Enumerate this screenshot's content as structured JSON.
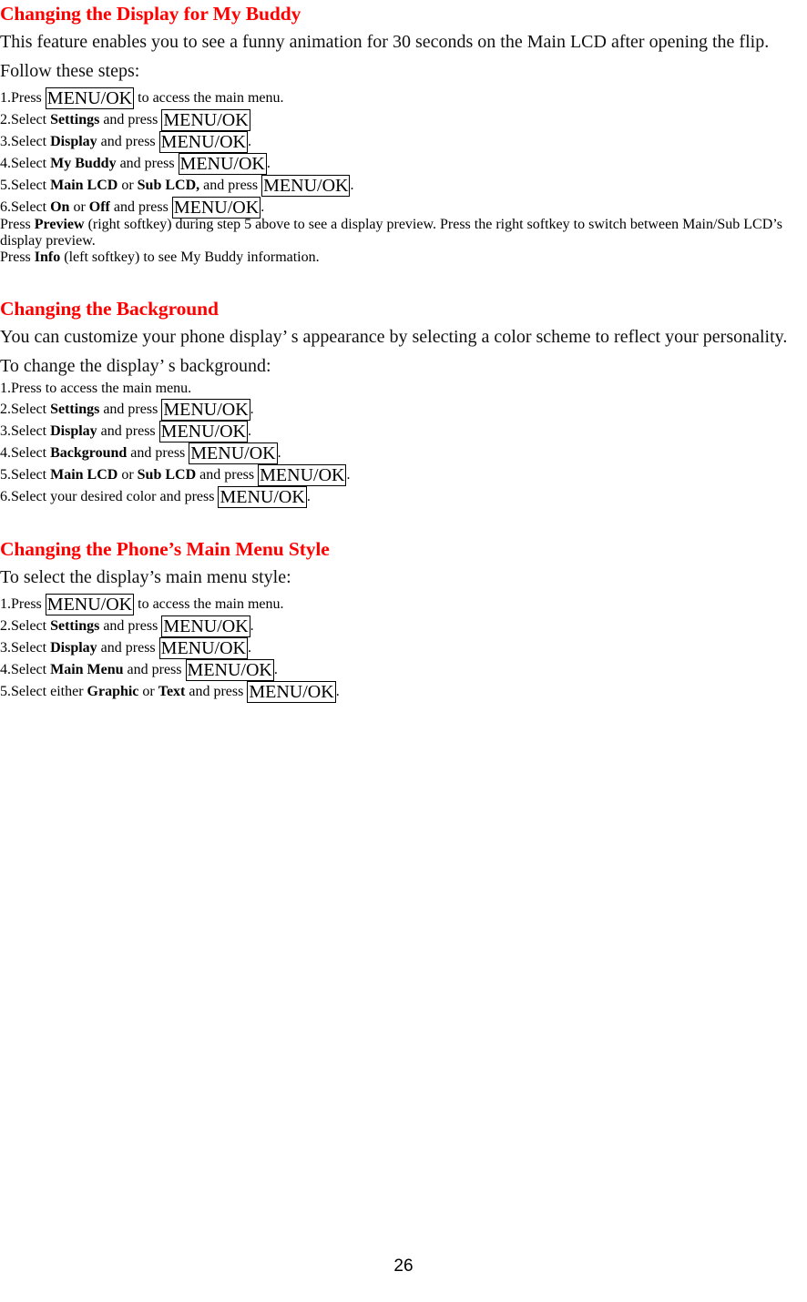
{
  "document": {
    "page_number": "26",
    "heading_color": "#FF0000",
    "body_color": "#000000"
  },
  "sections": [
    {
      "heading": "Changing the Display for My Buddy",
      "intro_lines": [
        "This feature enables you to see a funny animation for 30 seconds on the Main LCD after opening the flip.",
        "Follow these steps:"
      ],
      "steps": [
        {
          "num": "1.",
          "parts": [
            {
              "t": "text",
              "v": "Press "
            },
            {
              "t": "key",
              "v": "MENU/OK"
            },
            {
              "t": "text",
              "v": " to access the main menu."
            }
          ]
        },
        {
          "num": "2.",
          "parts": [
            {
              "t": "text",
              "v": "Select "
            },
            {
              "t": "bold",
              "v": "Settings"
            },
            {
              "t": "text",
              "v": " and press "
            },
            {
              "t": "key",
              "v": "MENU/OK"
            }
          ]
        },
        {
          "num": "3.",
          "parts": [
            {
              "t": "text",
              "v": "Select "
            },
            {
              "t": "bold",
              "v": "Display"
            },
            {
              "t": "text",
              "v": " and press "
            },
            {
              "t": "key",
              "v": "MENU/OK"
            },
            {
              "t": "text",
              "v": "."
            }
          ]
        },
        {
          "num": "4.",
          "parts": [
            {
              "t": "text",
              "v": "Select "
            },
            {
              "t": "bold",
              "v": "My Buddy"
            },
            {
              "t": "text",
              "v": " and press "
            },
            {
              "t": "key",
              "v": "MENU/OK"
            },
            {
              "t": "text",
              "v": "."
            }
          ]
        },
        {
          "num": "5.",
          "parts": [
            {
              "t": "text",
              "v": "Select "
            },
            {
              "t": "bold",
              "v": "Main LCD"
            },
            {
              "t": "text",
              "v": " or "
            },
            {
              "t": "bold",
              "v": "Sub LCD,"
            },
            {
              "t": "text",
              "v": " and press "
            },
            {
              "t": "key",
              "v": "MENU/OK"
            },
            {
              "t": "text",
              "v": "."
            }
          ]
        },
        {
          "num": "6.",
          "parts": [
            {
              "t": "text",
              "v": "Select "
            },
            {
              "t": "bold",
              "v": "On"
            },
            {
              "t": "text",
              "v": " or "
            },
            {
              "t": "bold",
              "v": "Off"
            },
            {
              "t": "text",
              "v": " and press "
            },
            {
              "t": "key",
              "v": "MENU/OK"
            },
            {
              "t": "text",
              "v": "."
            }
          ]
        }
      ],
      "bullets": [
        {
          "parts": [
            {
              "t": "text",
              "v": "Press "
            },
            {
              "t": "bold",
              "v": "Preview"
            },
            {
              "t": "text",
              "v": " (right softkey) during step 5 above to see a display preview. Press the right softkey to switch between Main/Sub LCD’s display preview."
            }
          ]
        },
        {
          "parts": [
            {
              "t": "text",
              "v": "Press "
            },
            {
              "t": "bold",
              "v": "Info"
            },
            {
              "t": "text",
              "v": " (left softkey) to see My Buddy information."
            }
          ]
        }
      ]
    },
    {
      "heading": "Changing the Background",
      "intro_lines": [
        "You can customize your phone display’ s appearance by selecting a color scheme to reflect your personality.",
        "To change the display’ s background:"
      ],
      "steps": [
        {
          "num": "1.",
          "parts": [
            {
              "t": "text",
              "v": "Press to access the main menu."
            }
          ]
        },
        {
          "num": "2.",
          "parts": [
            {
              "t": "text",
              "v": "Select "
            },
            {
              "t": "bold",
              "v": "Settings"
            },
            {
              "t": "text",
              "v": " and press "
            },
            {
              "t": "key",
              "v": "MENU/OK"
            },
            {
              "t": "text",
              "v": "."
            }
          ]
        },
        {
          "num": "3.",
          "parts": [
            {
              "t": "text",
              "v": "Select "
            },
            {
              "t": "bold",
              "v": "Display"
            },
            {
              "t": "text",
              "v": " and press "
            },
            {
              "t": "key",
              "v": "MENU/OK"
            },
            {
              "t": "text",
              "v": "."
            }
          ]
        },
        {
          "num": "4.",
          "parts": [
            {
              "t": "text",
              "v": "Select "
            },
            {
              "t": "bold",
              "v": "Background"
            },
            {
              "t": "text",
              "v": " and press "
            },
            {
              "t": "key",
              "v": "MENU/OK"
            },
            {
              "t": "text",
              "v": "."
            }
          ]
        },
        {
          "num": "5.",
          "parts": [
            {
              "t": "text",
              "v": "Select "
            },
            {
              "t": "bold",
              "v": "Main LCD"
            },
            {
              "t": "text",
              "v": " or "
            },
            {
              "t": "bold",
              "v": "Sub LCD"
            },
            {
              "t": "text",
              "v": " and press "
            },
            {
              "t": "key",
              "v": "MENU/OK"
            },
            {
              "t": "text",
              "v": "."
            }
          ]
        },
        {
          "num": "6.",
          "parts": [
            {
              "t": "text",
              "v": "Select your desired color and press "
            },
            {
              "t": "key",
              "v": "MENU/OK"
            },
            {
              "t": "text",
              "v": "."
            }
          ]
        }
      ],
      "bullets": []
    },
    {
      "heading": "Changing the Phone’s Main Menu Style",
      "intro_lines": [
        "To select the display’s main menu style:"
      ],
      "steps": [
        {
          "num": "1.",
          "parts": [
            {
              "t": "text",
              "v": "Press "
            },
            {
              "t": "key",
              "v": "MENU/OK"
            },
            {
              "t": "text",
              "v": " to access the main menu."
            }
          ]
        },
        {
          "num": "2.",
          "parts": [
            {
              "t": "text",
              "v": "Select "
            },
            {
              "t": "bold",
              "v": "Settings"
            },
            {
              "t": "text",
              "v": " and press "
            },
            {
              "t": "key",
              "v": "MENU/OK"
            },
            {
              "t": "text",
              "v": "."
            }
          ]
        },
        {
          "num": "3.",
          "parts": [
            {
              "t": "text",
              "v": "Select "
            },
            {
              "t": "bold",
              "v": "Display"
            },
            {
              "t": "text",
              "v": " and press "
            },
            {
              "t": "key",
              "v": "MENU/OK"
            },
            {
              "t": "text",
              "v": "."
            }
          ]
        },
        {
          "num": "4.",
          "parts": [
            {
              "t": "text",
              "v": "Select "
            },
            {
              "t": "bold",
              "v": "Main Menu"
            },
            {
              "t": "text",
              "v": " and press "
            },
            {
              "t": "key",
              "v": "MENU/OK"
            },
            {
              "t": "text",
              "v": "."
            }
          ]
        },
        {
          "num": "5.",
          "parts": [
            {
              "t": "text",
              "v": "Select either "
            },
            {
              "t": "bold",
              "v": "Graphic"
            },
            {
              "t": "text",
              "v": " or "
            },
            {
              "t": "bold",
              "v": "Text"
            },
            {
              "t": "text",
              "v": " and press "
            },
            {
              "t": "key",
              "v": "MENU/OK"
            },
            {
              "t": "text",
              "v": "."
            }
          ]
        }
      ],
      "bullets": []
    }
  ]
}
